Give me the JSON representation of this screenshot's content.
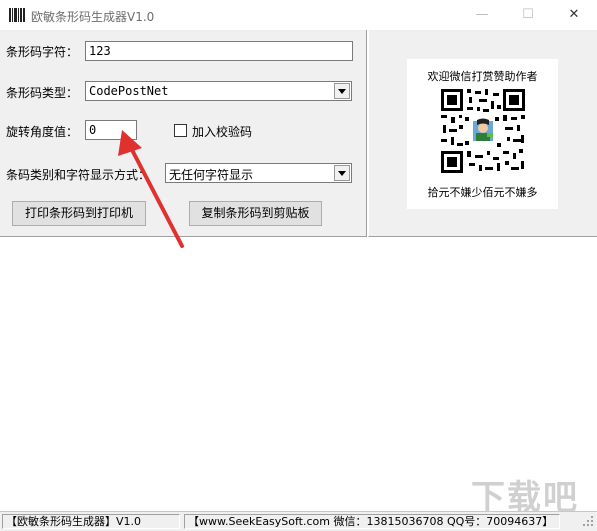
{
  "window": {
    "title": "欧敏条形码生成器V1.0",
    "minimize": "—",
    "maximize": "☐",
    "close": "✕"
  },
  "form": {
    "barcode_text_label": "条形码字符：",
    "barcode_text_value": "123",
    "barcode_type_label": "条形码类型：",
    "barcode_type_value": "CodePostNet",
    "rotation_label": "旋转角度值：",
    "rotation_value": "0",
    "checksum_label": "加入校验码",
    "checksum_checked": false,
    "display_mode_label": "条码类别和字符显示方式：",
    "display_mode_value": "无任何字符显示",
    "print_button": "打印条形码到打印机",
    "copy_button": "复制条形码到剪贴板"
  },
  "donate": {
    "caption": "欢迎微信打赏赞助作者",
    "subcaption": "拾元不嫌少佰元不嫌多"
  },
  "statusbar": {
    "app_name": "【欧敏条形码生成器】V1.0",
    "contact": "【www.SeekEasySoft.com 微信：13815036708 QQ号：70094637】"
  },
  "watermark": "下载吧",
  "colors": {
    "panel_bg": "#f0f0f0",
    "arrow_red": "#e0312f"
  }
}
